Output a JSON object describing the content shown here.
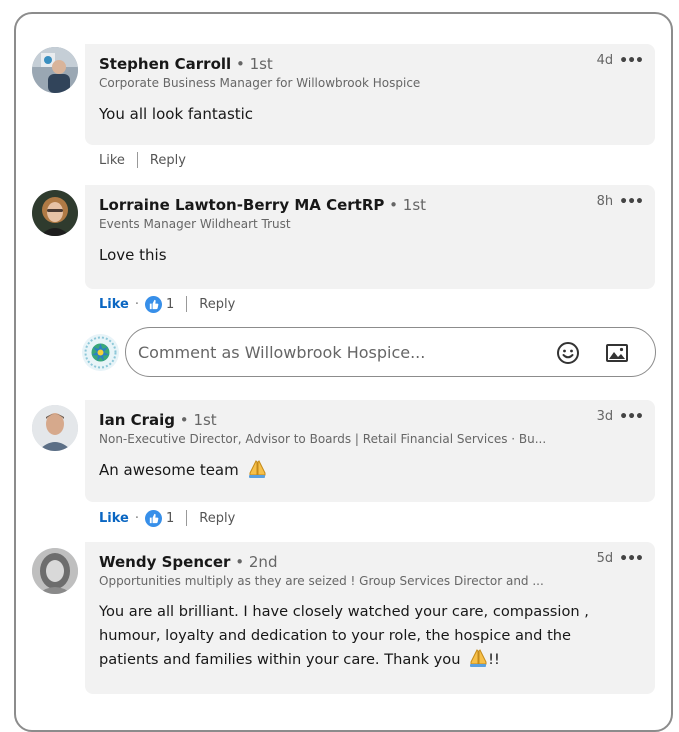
{
  "comments": [
    {
      "name": "Stephen Carroll",
      "degree": "1st",
      "headline": "Corporate Business Manager for Willowbrook Hospice",
      "text": "You all look fantastic",
      "time": "4d",
      "like_label": "Like",
      "reply_label": "Reply"
    },
    {
      "name": "Lorraine Lawton-Berry MA CertRP",
      "degree": "1st",
      "headline": "Events Manager Wildheart Trust",
      "text": "Love this",
      "time": "8h",
      "like_label": "Like",
      "reaction_count": "1",
      "reply_label": "Reply"
    },
    {
      "name": "Ian Craig",
      "degree": "1st",
      "headline": "Non-Executive Director, Advisor to Boards | Retail Financial Services · Bu...",
      "text": "An awesome team",
      "time": "3d",
      "like_label": "Like",
      "reaction_count": "1",
      "reply_label": "Reply"
    },
    {
      "name": "Wendy Spencer",
      "degree": "2nd",
      "headline": "Opportunities multiply as they are seized ! Group Services Director and ...",
      "text_lines": [
        "You are all brilliant. I have closely watched your care, compassion ,",
        "humour, loyalty and dedication to your role, the hospice and the",
        "patients and families within your care. Thank you"
      ],
      "text_suffix": "!!",
      "time": "5d"
    }
  ],
  "composer": {
    "placeholder": "Comment as Willowbrook Hospice..."
  },
  "separator": "•",
  "dot_separator": "·",
  "more_glyph": "•••",
  "colors": {
    "accent": "#0a66c2",
    "reaction": "#378fe9",
    "bubble": "#f2f2f2"
  },
  "icons": [
    "more-icon",
    "like-reaction-icon",
    "emoji-icon",
    "image-icon",
    "praying-hands-icon"
  ]
}
